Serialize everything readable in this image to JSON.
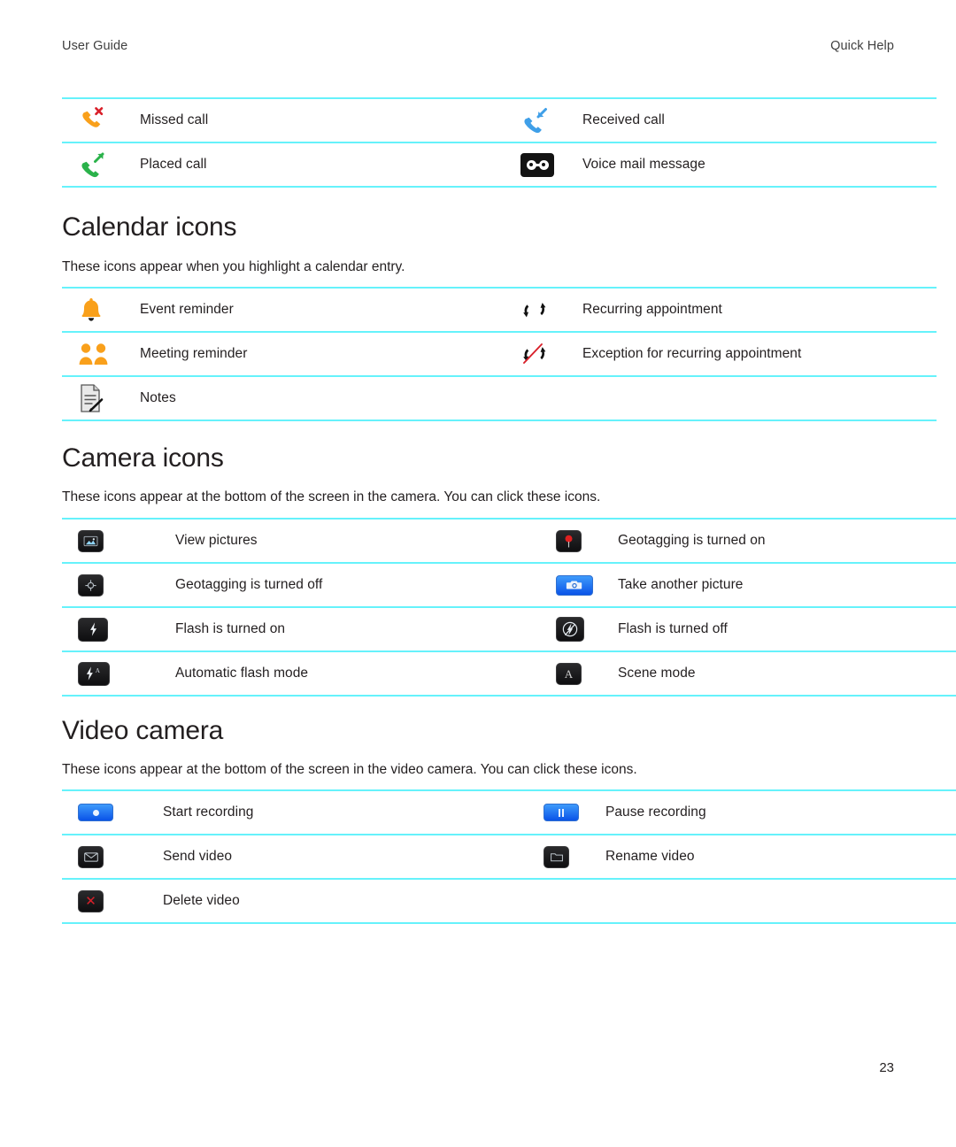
{
  "header": {
    "left": "User Guide",
    "right": "Quick Help"
  },
  "folio": "23",
  "colors": {
    "rule": "#66f2fb",
    "text": "#231f20",
    "orange": "#f9a01b",
    "green": "#2ab24a",
    "blue": "#3f9fe8",
    "red": "#d9202a",
    "button_dark": "#1b1b1d",
    "button_blue": "#1463e8"
  },
  "phone_table": {
    "rows": [
      {
        "left": {
          "icon": "missed-call-icon",
          "label": "Missed call"
        },
        "right": {
          "icon": "received-call-icon",
          "label": "Received call"
        }
      },
      {
        "left": {
          "icon": "placed-call-icon",
          "label": "Placed call"
        },
        "right": {
          "icon": "voice-mail-icon",
          "label": "Voice mail message"
        }
      }
    ]
  },
  "calendar_section": {
    "heading": "Calendar icons",
    "intro": "These icons appear when you highlight a calendar entry.",
    "rows": [
      {
        "left": {
          "icon": "bell-icon",
          "label": "Event reminder"
        },
        "right": {
          "icon": "recurring-icon",
          "label": "Recurring appointment"
        }
      },
      {
        "left": {
          "icon": "people-icon",
          "label": "Meeting reminder"
        },
        "right": {
          "icon": "recurring-exception-icon",
          "label": "Exception for recurring appointment"
        }
      },
      {
        "left": {
          "icon": "notes-icon",
          "label": "Notes"
        },
        "right": {
          "icon": "",
          "label": ""
        }
      }
    ]
  },
  "camera_section": {
    "heading": "Camera icons",
    "intro": "These icons appear at the bottom of the screen in the camera. You can click these icons.",
    "rows": [
      {
        "left": {
          "icon": "view-pictures-icon",
          "label": "View pictures"
        },
        "right": {
          "icon": "geotagging-on-icon",
          "label": "Geotagging is turned on"
        }
      },
      {
        "left": {
          "icon": "geotagging-off-icon",
          "label": "Geotagging is turned off"
        },
        "right": {
          "icon": "take-picture-icon",
          "label": "Take another picture"
        }
      },
      {
        "left": {
          "icon": "flash-on-icon",
          "label": "Flash is turned on"
        },
        "right": {
          "icon": "flash-off-icon",
          "label": "Flash is turned off"
        }
      },
      {
        "left": {
          "icon": "flash-auto-icon",
          "label": "Automatic flash mode"
        },
        "right": {
          "icon": "scene-mode-icon",
          "label": "Scene mode"
        }
      }
    ]
  },
  "video_section": {
    "heading": "Video camera",
    "intro": "These icons appear at the bottom of the screen in the video camera. You can click these icons.",
    "rows": [
      {
        "left": {
          "icon": "start-recording-icon",
          "label": "Start recording"
        },
        "right": {
          "icon": "pause-recording-icon",
          "label": "Pause recording"
        }
      },
      {
        "left": {
          "icon": "send-video-icon",
          "label": "Send video"
        },
        "right": {
          "icon": "rename-video-icon",
          "label": "Rename video"
        }
      },
      {
        "left": {
          "icon": "delete-video-icon",
          "label": "Delete video"
        },
        "right": {
          "icon": "",
          "label": ""
        }
      }
    ]
  }
}
